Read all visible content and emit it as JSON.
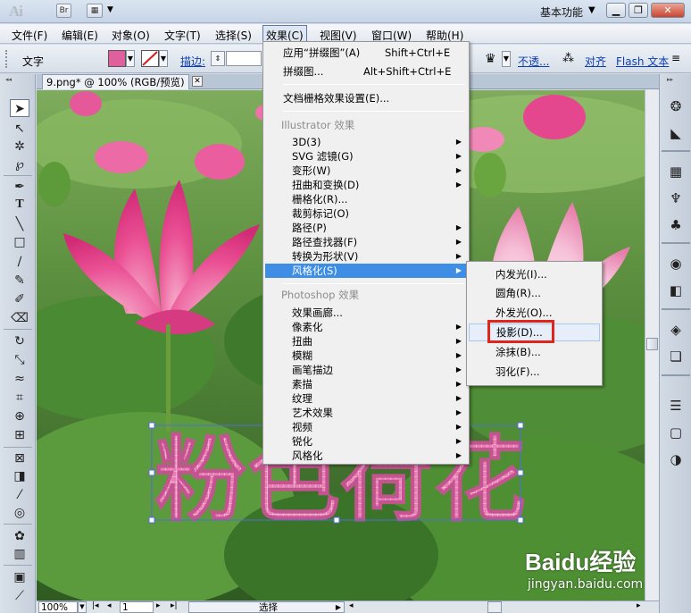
{
  "titlebar": {
    "app_logo": "Ai",
    "bridge_button": "Br",
    "workspace": "基本功能",
    "minimize": "▁",
    "restore": "❐",
    "close": "✕"
  },
  "menubar": {
    "items": [
      "文件(F)",
      "编辑(E)",
      "对象(O)",
      "文字(T)",
      "选择(S)",
      "效果(C)",
      "视图(V)",
      "窗口(W)",
      "帮助(H)"
    ]
  },
  "controlbar": {
    "type_label": "文字",
    "stroke_label": "描边:",
    "opacity_label": "不透...",
    "align_label": "对齐",
    "flash_label": "Flash 文本",
    "fill_color": "#e0609e"
  },
  "document": {
    "tab_title": "9.png* @ 100% (RGB/预览)",
    "close_glyph": "✕"
  },
  "canvas": {
    "artwork_text": "粉色荷花"
  },
  "statusbar": {
    "zoom": "100%",
    "page": "1",
    "tool": "选择"
  },
  "effect_menu": {
    "top_items": [
      {
        "label": "应用“拼缀图”(A)",
        "shortcut": "Shift+Ctrl+E"
      },
      {
        "label": "拼缀图...",
        "shortcut": "Alt+Shift+Ctrl+E"
      }
    ],
    "raster_settings": "文档栅格效果设置(E)...",
    "illustrator_header": "Illustrator 效果",
    "illustrator_items": [
      "3D(3)",
      "SVG 滤镜(G)",
      "变形(W)",
      "扭曲和变换(D)",
      "栅格化(R)...",
      "裁剪标记(O)",
      "路径(P)",
      "路径查找器(F)",
      "转换为形状(V)",
      "风格化(S)"
    ],
    "photoshop_header": "Photoshop 效果",
    "photoshop_items": [
      "效果画廊...",
      "像素化",
      "扭曲",
      "模糊",
      "画笔描边",
      "素描",
      "纹理",
      "艺术效果",
      "视频",
      "锐化",
      "风格化"
    ]
  },
  "stylize_submenu": {
    "items": [
      "内发光(I)...",
      "圆角(R)...",
      "外发光(O)...",
      "投影(D)...",
      "涂抹(B)...",
      "羽化(F)..."
    ]
  },
  "watermark": {
    "brand": "Baidu经验",
    "url": "jingyan.baidu.com"
  }
}
